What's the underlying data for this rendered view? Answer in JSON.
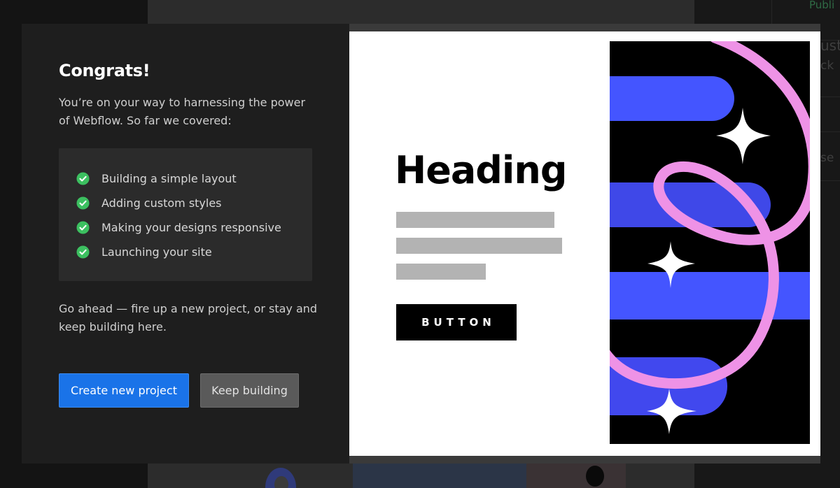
{
  "background": {
    "publish_fragment": "Publi",
    "fragments": [
      "ust",
      "ck",
      "se"
    ]
  },
  "modal": {
    "title": "Congrats!",
    "intro": "You’re on your way to harnessing the power of Webflow. So far we covered:",
    "checklist": [
      "Building a simple layout",
      "Adding custom styles",
      "Making your designs responsive",
      "Launching your site"
    ],
    "outro": "Go ahead — fire up a new project, or stay and keep building here.",
    "primary_button": "Create new project",
    "secondary_button": "Keep building"
  },
  "preview": {
    "heading": "Heading",
    "button_label": "BUTTON"
  },
  "icons": [
    "check-circle-icon",
    "sparkle-icon"
  ],
  "colors": {
    "primary": "#1a73e8",
    "success": "#3cc060",
    "art_blue": "#4455ff",
    "art_pink": "#ee92e6"
  }
}
